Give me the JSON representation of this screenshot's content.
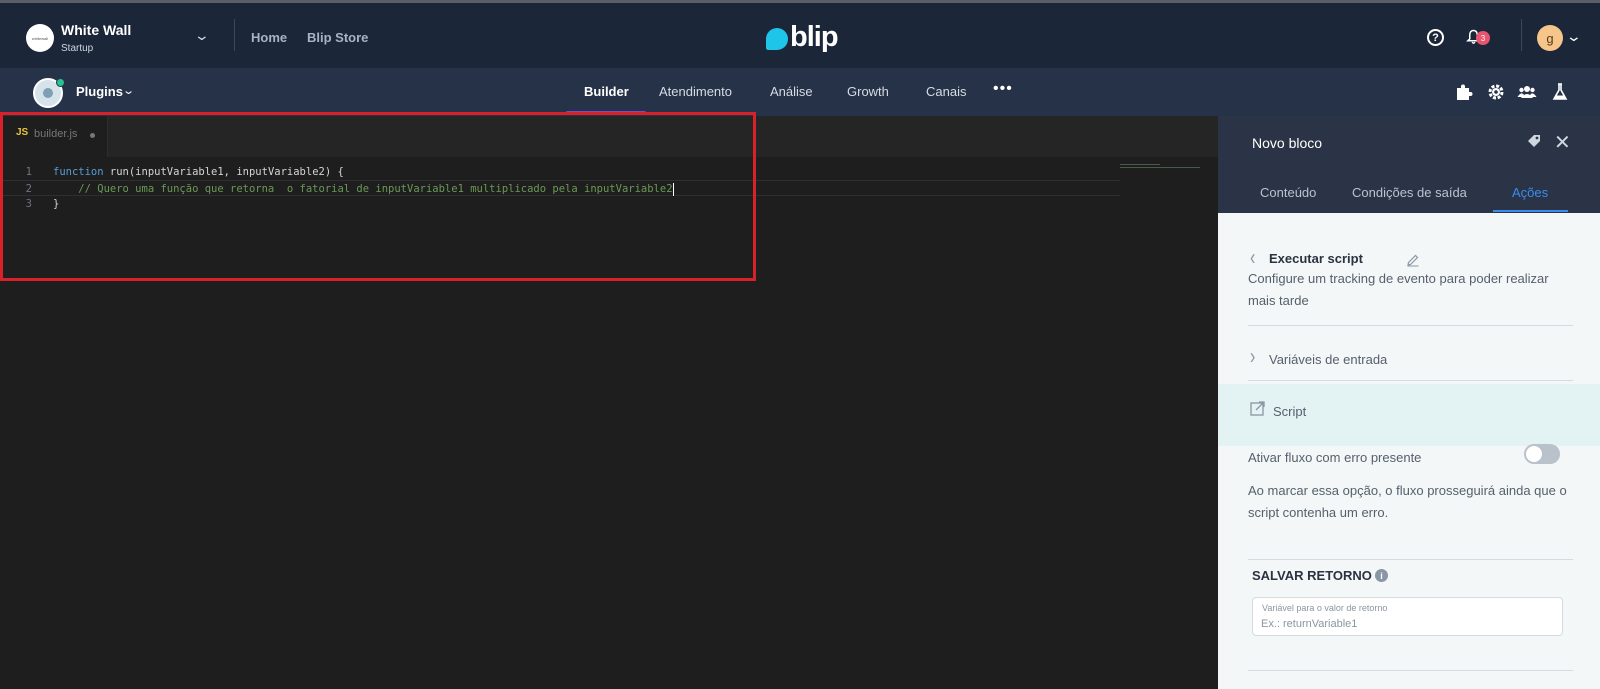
{
  "header": {
    "workspace_name": "White Wall",
    "workspace_plan": "Startup",
    "workspace_logo_text": "whitewall",
    "links": [
      "Home",
      "Blip Store"
    ],
    "brand": "blip",
    "help_glyph": "?",
    "notification_count": "3",
    "user_initial": "g"
  },
  "nav": {
    "bot_name": "Plugins",
    "tabs": [
      "Builder",
      "Atendimento",
      "Análise",
      "Growth",
      "Canais"
    ],
    "active_tab": "Builder",
    "more": "•••",
    "tool_icons": [
      "puzzle-icon",
      "gear-icon",
      "users-icon",
      "flask-icon"
    ]
  },
  "editor": {
    "file_badge": "JS",
    "file_name": "builder.js",
    "lines": [
      {
        "num": "1",
        "kw": "function",
        "text": " run(inputVariable1, inputVariable2) {"
      },
      {
        "num": "2",
        "comment": "    // Quero uma função que retorna  o fatorial de inputVariable1 multiplicado pela inputVariable2"
      },
      {
        "num": "3",
        "text": "}"
      }
    ]
  },
  "panel": {
    "block_title": "Novo bloco",
    "tabs": [
      "Conteúdo",
      "Condições de saída",
      "Ações"
    ],
    "active_tab": "Ações",
    "action_title": "Executar script",
    "action_description": "Configure um tracking de evento para poder realizar mais tarde",
    "input_variables_label": "Variáveis de entrada",
    "script_label": "Script",
    "error_flow_label": "Ativar fluxo com erro presente",
    "error_flow_enabled": false,
    "error_flow_description": "Ao marcar essa opção, o fluxo prosseguirá ainda que o script contenha um erro.",
    "save_return_title": "SALVAR RETORNO",
    "return_field_label": "Variável para o valor de retorno",
    "return_field_placeholder": "Ex.: returnVariable1",
    "return_field_value": ""
  },
  "colors": {
    "header_bg": "#1c2639",
    "nav_bg": "#263247",
    "accent": "#3b8ced",
    "highlight_box": "#d9212a",
    "brand_bubble": "#1ec5e8"
  }
}
